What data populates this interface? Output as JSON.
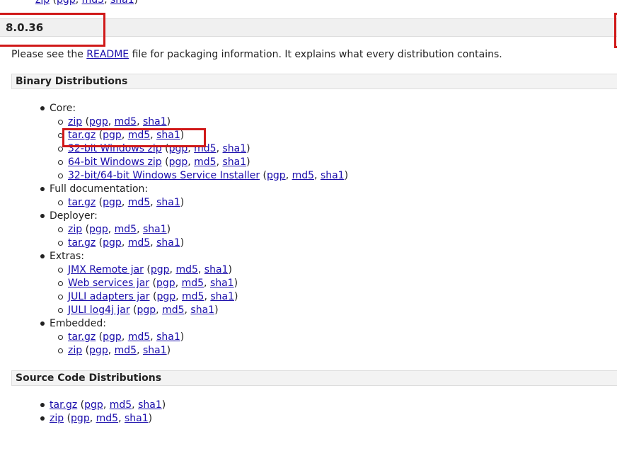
{
  "top_partial": {
    "main": "zip",
    "pgp": "pgp",
    "md5": "md5",
    "sha1": "sha1"
  },
  "version": "8.0.36",
  "intro": {
    "before": "Please see the ",
    "link": "README",
    "after": " file for packaging information. It explains what every distribution contains."
  },
  "binary": {
    "heading": "Binary Distributions",
    "groups": [
      {
        "label": "Core:",
        "items": [
          {
            "main": "zip",
            "pgp": "pgp",
            "md5": "md5",
            "sha1": "sha1"
          },
          {
            "main": "tar.gz",
            "pgp": "pgp",
            "md5": "md5",
            "sha1": "sha1"
          },
          {
            "main": "32-bit Windows zip",
            "pgp": "pgp",
            "md5": "md5",
            "sha1": "sha1"
          },
          {
            "main": "64-bit Windows zip",
            "pgp": "pgp",
            "md5": "md5",
            "sha1": "sha1"
          },
          {
            "main": "32-bit/64-bit Windows Service Installer",
            "pgp": "pgp",
            "md5": "md5",
            "sha1": "sha1"
          }
        ]
      },
      {
        "label": "Full documentation:",
        "items": [
          {
            "main": "tar.gz",
            "pgp": "pgp",
            "md5": "md5",
            "sha1": "sha1"
          }
        ]
      },
      {
        "label": "Deployer:",
        "items": [
          {
            "main": "zip",
            "pgp": "pgp",
            "md5": "md5",
            "sha1": "sha1"
          },
          {
            "main": "tar.gz",
            "pgp": "pgp",
            "md5": "md5",
            "sha1": "sha1"
          }
        ]
      },
      {
        "label": "Extras:",
        "items": [
          {
            "main": "JMX Remote jar",
            "pgp": "pgp",
            "md5": "md5",
            "sha1": "sha1"
          },
          {
            "main": "Web services jar",
            "pgp": "pgp",
            "md5": "md5",
            "sha1": "sha1"
          },
          {
            "main": "JULI adapters jar",
            "pgp": "pgp",
            "md5": "md5",
            "sha1": "sha1"
          },
          {
            "main": "JULI log4j jar",
            "pgp": "pgp",
            "md5": "md5",
            "sha1": "sha1"
          }
        ]
      },
      {
        "label": "Embedded:",
        "items": [
          {
            "main": "tar.gz",
            "pgp": "pgp",
            "md5": "md5",
            "sha1": "sha1"
          },
          {
            "main": "zip",
            "pgp": "pgp",
            "md5": "md5",
            "sha1": "sha1"
          }
        ]
      }
    ]
  },
  "source": {
    "heading": "Source Code Distributions",
    "items": [
      {
        "main": "tar.gz",
        "pgp": "pgp",
        "md5": "md5",
        "sha1": "sha1"
      },
      {
        "main": "zip",
        "pgp": "pgp",
        "md5": "md5",
        "sha1": "sha1"
      }
    ]
  },
  "colors": {
    "link": "#1a0dab",
    "highlight": "#d01919",
    "section_bg": "#f3f3f3"
  }
}
